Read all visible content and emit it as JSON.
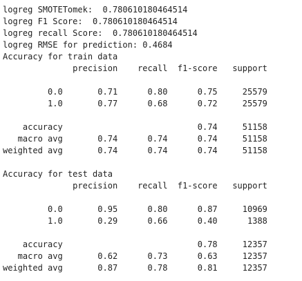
{
  "output": {
    "lines": [
      "logreg SMOTETomek:  0.780610180464514",
      "logreg F1 Score:  0.780610180464514",
      "logreg recall Score:  0.780610180464514",
      "logreg RMSE for prediction: 0.4684",
      "Accuracy for train data",
      "              precision    recall  f1-score   support",
      "",
      "         0.0       0.71      0.80      0.75     25579",
      "         1.0       0.77      0.68      0.72     25579",
      "",
      "    accuracy                           0.74     51158",
      "   macro avg       0.74      0.74      0.74     51158",
      "weighted avg       0.74      0.74      0.74     51158",
      "",
      "Accuracy for test data",
      "              precision    recall  f1-score   support",
      "",
      "         0.0       0.95      0.80      0.87     10969",
      "         1.0       0.29      0.66      0.40      1388",
      "",
      "    accuracy                           0.78     12357",
      "   macro avg       0.62      0.73      0.63     12357",
      "weighted avg       0.87      0.78      0.81     12357"
    ]
  }
}
